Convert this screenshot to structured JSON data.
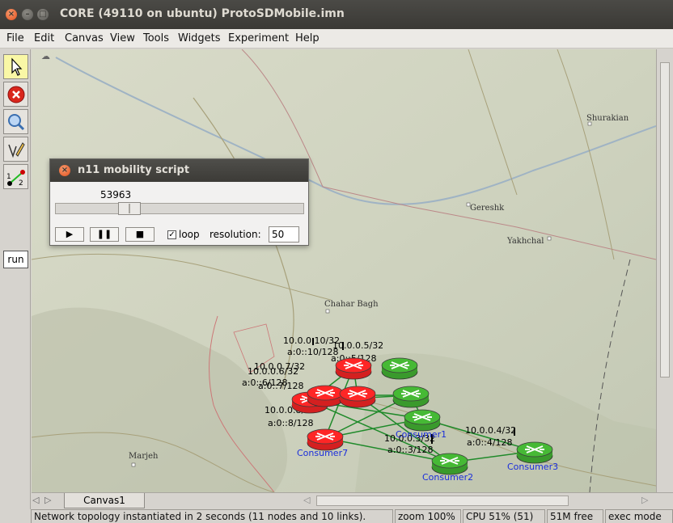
{
  "window": {
    "title": "CORE (49110 on ubuntu) ProtoSDMobile.imn",
    "close_glyph": "×",
    "minimize_glyph": "–",
    "maximize_glyph": "□"
  },
  "menu": {
    "items": [
      "File",
      "Edit",
      "Canvas",
      "View",
      "Tools",
      "Widgets",
      "Experiment",
      "Help"
    ]
  },
  "toolbar": {
    "tools": [
      {
        "name": "select-tool",
        "icon": "arrow-cursor-icon"
      },
      {
        "name": "stop-tool",
        "icon": "stop-icon"
      },
      {
        "name": "observe-tool",
        "icon": "magnifier-icon"
      },
      {
        "name": "plot-tool",
        "icon": "pencil-icon"
      },
      {
        "name": "twonode-tool",
        "icon": "two-node-link-icon"
      }
    ],
    "run_label": "run",
    "twonode_labels": [
      "1",
      "2"
    ]
  },
  "map": {
    "places": [
      "Shurakian",
      "Gereshk",
      "Yakhchal",
      "Chahar Bagh",
      "Marjeh"
    ]
  },
  "nodes": [
    {
      "name": "Consumer1",
      "color": "#3a9a2c"
    },
    {
      "name": "Consumer2",
      "color": "#3a9a2c"
    },
    {
      "name": "Consumer3",
      "color": "#3a9a2c"
    },
    {
      "name": "Consumer7",
      "color": "#d42020"
    }
  ],
  "addresses": [
    "10.0.0.10/32",
    "a:0::10/128",
    "10.0.0.5/32",
    "a:0::5/128",
    "10.0.0.6/32",
    "a:0::6/128",
    "10.0.0.7/32",
    "a:0::7/128",
    "10.0.0.8/32",
    "a:0::8/128",
    "10.0.0.3/32",
    "a:0::3/128",
    "10.0.0.4/32",
    "a:0::4/128"
  ],
  "mobility_dialog": {
    "title": "n11 mobility script",
    "close_glyph": "×",
    "time": "53963",
    "time_fraction": 0.28,
    "play_glyph": "▶",
    "pause_glyph": "❚❚",
    "stop_glyph": "■",
    "loop_checked": true,
    "loop_check_glyph": "✓",
    "loop_label": "loop",
    "resolution_label": "resolution:",
    "resolution_value": "50"
  },
  "tabs": [
    "Canvas1"
  ],
  "status": {
    "message": "Network topology instantiated in 2 seconds (11 nodes and 10 links).",
    "zoom": "zoom 100%",
    "cpu": "CPU 51% (51)",
    "memory": "51M free",
    "mode": "exec mode"
  },
  "colors": {
    "router_red": "#d42020",
    "router_green": "#3a9a2c",
    "link_green": "#1f8a2a",
    "label_blue": "#1a2ddb"
  }
}
